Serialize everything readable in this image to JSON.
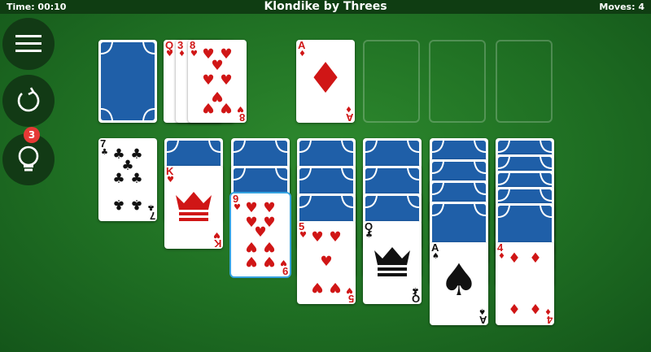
{
  "header": {
    "time": "Time: 00:10",
    "title": "Klondike by Threes",
    "moves": "Moves: 4"
  },
  "sidebar": {
    "menu_icon": "menu-icon",
    "undo_icon": "undo-icon",
    "hint_icon": "lightbulb-icon",
    "hint_count": "3"
  },
  "colors": {
    "felt": "#1f6f23",
    "topbar": "#0f3d12",
    "card_back": "#1f5fa8",
    "red_suit": "#d01616",
    "hint_badge": "#e53935",
    "selection": "#36a3e0"
  },
  "stock": {
    "face": "down"
  },
  "waste": [
    {
      "rank": "Q",
      "suit": "♥"
    },
    {
      "rank": "3",
      "suit": "♦"
    },
    {
      "rank": "8",
      "suit": "♥"
    }
  ],
  "foundations": [
    {
      "rank": "A",
      "suit": "♦"
    },
    {
      "rank": "",
      "suit": ""
    },
    {
      "rank": "",
      "suit": ""
    },
    {
      "rank": "",
      "suit": ""
    }
  ],
  "tableau": [
    {
      "hidden": 0,
      "face_up": [
        {
          "rank": "7",
          "suit": "♣"
        }
      ]
    },
    {
      "hidden": 1,
      "face_up": [
        {
          "rank": "K",
          "suit": "♥"
        }
      ]
    },
    {
      "hidden": 2,
      "face_up": [
        {
          "rank": "9",
          "suit": "♥"
        }
      ]
    },
    {
      "hidden": 3,
      "face_up": [
        {
          "rank": "5",
          "suit": "♥"
        }
      ]
    },
    {
      "hidden": 3,
      "face_up": [
        {
          "rank": "Q",
          "suit": "♣"
        }
      ]
    },
    {
      "hidden": 4,
      "face_up": [
        {
          "rank": "A",
          "suit": "♠"
        }
      ]
    },
    {
      "hidden": 5,
      "face_up": [
        {
          "rank": "4",
          "suit": "♦"
        }
      ]
    }
  ]
}
